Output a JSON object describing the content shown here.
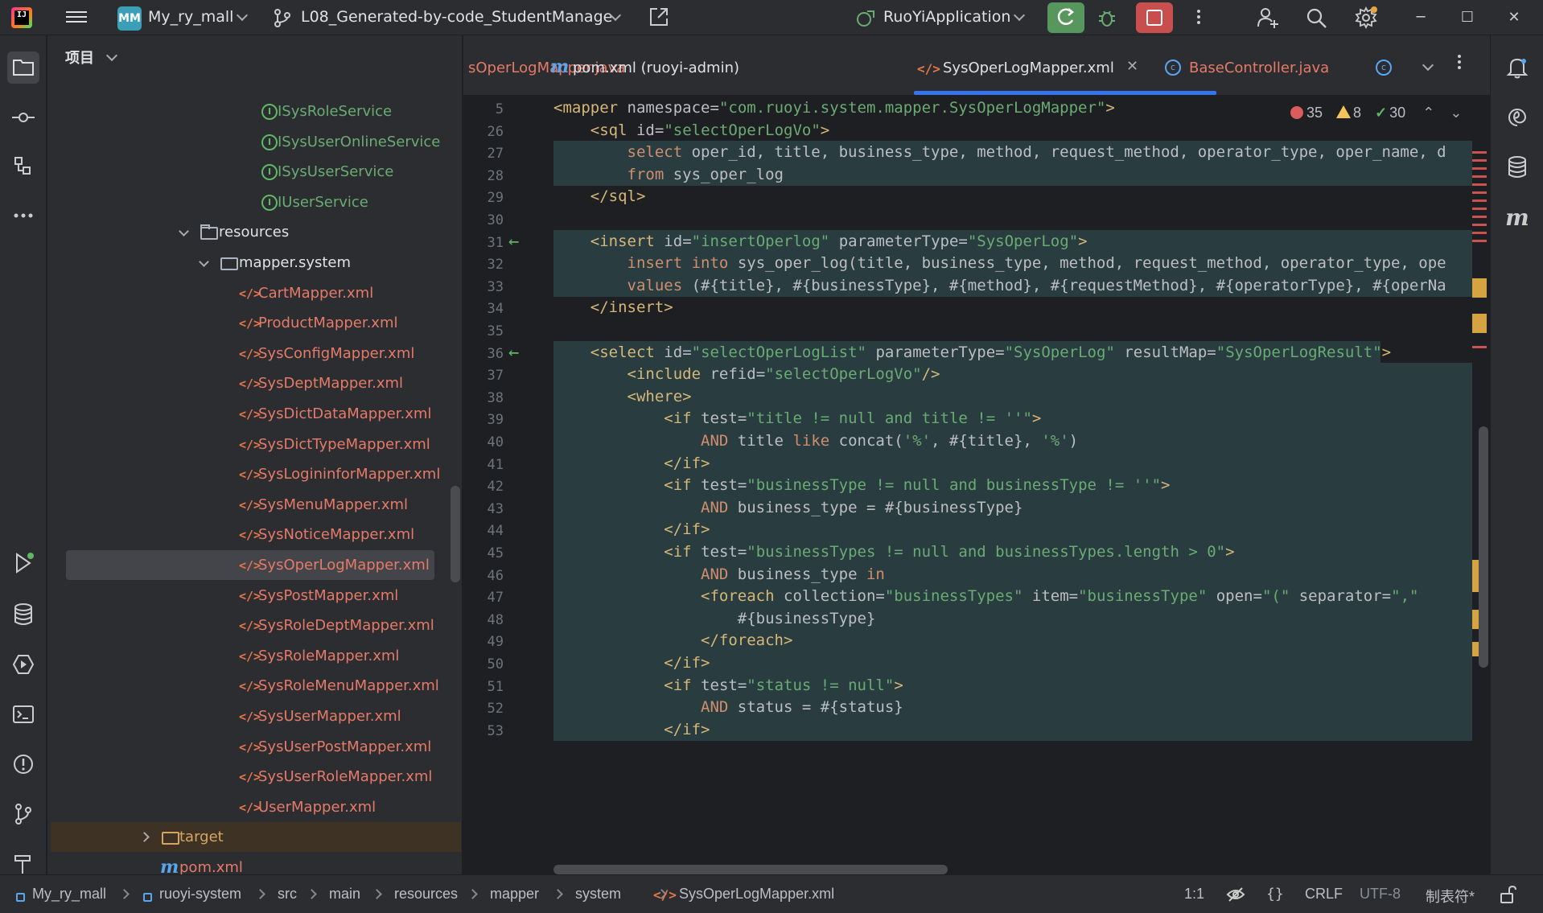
{
  "titlebar": {
    "project_badge": "MM",
    "project_name": "My_ry_mall",
    "branch_name": "L08_Generated-by-code_StudentManage",
    "run_config": "RuoYiApplication"
  },
  "project_panel": {
    "title": "项目",
    "tree": [
      {
        "label": "ISysRoleService",
        "kind": "interface"
      },
      {
        "label": "ISysUserOnlineService",
        "kind": "interface"
      },
      {
        "label": "ISysUserService",
        "kind": "interface"
      },
      {
        "label": "IUserService",
        "kind": "interface"
      },
      {
        "label": "resources",
        "kind": "folder"
      },
      {
        "label": "mapper.system",
        "kind": "folder"
      },
      {
        "label": "CartMapper.xml",
        "kind": "xml"
      },
      {
        "label": "ProductMapper.xml",
        "kind": "xml"
      },
      {
        "label": "SysConfigMapper.xml",
        "kind": "xml"
      },
      {
        "label": "SysDeptMapper.xml",
        "kind": "xml"
      },
      {
        "label": "SysDictDataMapper.xml",
        "kind": "xml"
      },
      {
        "label": "SysDictTypeMapper.xml",
        "kind": "xml"
      },
      {
        "label": "SysLogininforMapper.xml",
        "kind": "xml"
      },
      {
        "label": "SysMenuMapper.xml",
        "kind": "xml"
      },
      {
        "label": "SysNoticeMapper.xml",
        "kind": "xml"
      },
      {
        "label": "SysOperLogMapper.xml",
        "kind": "xml",
        "selected": true
      },
      {
        "label": "SysPostMapper.xml",
        "kind": "xml"
      },
      {
        "label": "SysRoleDeptMapper.xml",
        "kind": "xml"
      },
      {
        "label": "SysRoleMapper.xml",
        "kind": "xml"
      },
      {
        "label": "SysRoleMenuMapper.xml",
        "kind": "xml"
      },
      {
        "label": "SysUserMapper.xml",
        "kind": "xml"
      },
      {
        "label": "SysUserPostMapper.xml",
        "kind": "xml"
      },
      {
        "label": "SysUserRoleMapper.xml",
        "kind": "xml"
      },
      {
        "label": "UserMapper.xml",
        "kind": "xml"
      },
      {
        "label": "target",
        "kind": "folder-excluded"
      },
      {
        "label": "pom.xml",
        "kind": "maven"
      }
    ]
  },
  "tabs": [
    {
      "label": "sOperLogMapper.java"
    },
    {
      "label": "pom.xml (ruoyi-admin)"
    },
    {
      "label": "SysOperLogMapper.xml",
      "active": true
    },
    {
      "label": "BaseController.java"
    }
  ],
  "inspections": {
    "errors": "35",
    "warnings": "8",
    "ok": "30"
  },
  "editor": {
    "lines": [
      {
        "n": "5",
        "code": "<mapper namespace=\"com.ruoyi.system.mapper.SysOperLogMapper\">"
      },
      {
        "n": "26",
        "code": "    <sql id=\"selectOperLogVo\">"
      },
      {
        "n": "27",
        "code": "        select oper_id, title, business_type, method, request_method, operator_type, oper_name, d"
      },
      {
        "n": "28",
        "code": "        from sys_oper_log"
      },
      {
        "n": "29",
        "code": "    </sql>"
      },
      {
        "n": "30",
        "code": ""
      },
      {
        "n": "31",
        "code": "    <insert id=\"insertOperlog\" parameterType=\"SysOperLog\">"
      },
      {
        "n": "32",
        "code": "        insert into sys_oper_log(title, business_type, method, request_method, operator_type, ope"
      },
      {
        "n": "33",
        "code": "        values (#{title}, #{businessType}, #{method}, #{requestMethod}, #{operatorType}, #{operNa"
      },
      {
        "n": "34",
        "code": "    </insert>"
      },
      {
        "n": "35",
        "code": ""
      },
      {
        "n": "36",
        "code": "    <select id=\"selectOperLogList\" parameterType=\"SysOperLog\" resultMap=\"SysOperLogResult\">"
      },
      {
        "n": "37",
        "code": "        <include refid=\"selectOperLogVo\"/>"
      },
      {
        "n": "38",
        "code": "        <where>"
      },
      {
        "n": "39",
        "code": "            <if test=\"title != null and title != ''\">"
      },
      {
        "n": "40",
        "code": "                AND title like concat('%', #{title}, '%')"
      },
      {
        "n": "41",
        "code": "            </if>"
      },
      {
        "n": "42",
        "code": "            <if test=\"businessType != null and businessType != ''\">"
      },
      {
        "n": "43",
        "code": "                AND business_type = #{businessType}"
      },
      {
        "n": "44",
        "code": "            </if>"
      },
      {
        "n": "45",
        "code": "            <if test=\"businessTypes != null and businessTypes.length > 0\">"
      },
      {
        "n": "46",
        "code": "                AND business_type in"
      },
      {
        "n": "47",
        "code": "                <foreach collection=\"businessTypes\" item=\"businessType\" open=\"(\" separator=\",\""
      },
      {
        "n": "48",
        "code": "                    #{businessType}"
      },
      {
        "n": "49",
        "code": "                </foreach>"
      },
      {
        "n": "50",
        "code": "            </if>"
      },
      {
        "n": "51",
        "code": "            <if test=\"status != null\">"
      },
      {
        "n": "52",
        "code": "                AND status = #{status}"
      },
      {
        "n": "53",
        "code": "            </if>"
      }
    ]
  },
  "statusbar": {
    "crumbs": [
      "My_ry_mall",
      "ruoyi-system",
      "src",
      "main",
      "resources",
      "mapper",
      "system",
      "SysOperLogMapper.xml"
    ],
    "position": "1:1",
    "line_sep": "CRLF",
    "encoding": "UTF-8",
    "indent": "制表符*"
  }
}
